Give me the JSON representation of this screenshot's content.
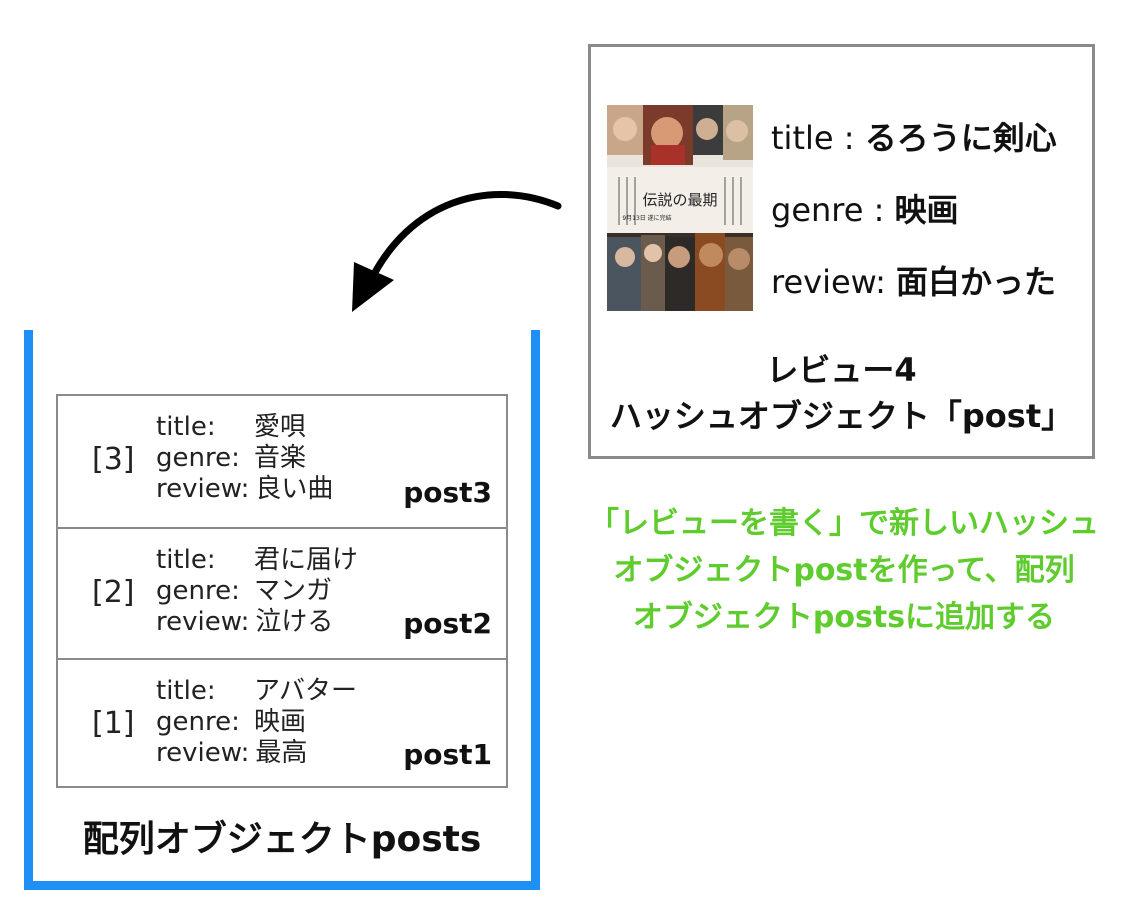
{
  "array": {
    "caption": "配列オブジェクトposts",
    "rows": [
      {
        "index": "[3]",
        "title_key": "title:",
        "title_value": "愛唄",
        "genre_key": "genre:",
        "genre_value": "音楽",
        "review_key": "review:",
        "review_value": "良い曲",
        "name": "post3"
      },
      {
        "index": "[2]",
        "title_key": "title:",
        "title_value": "君に届け",
        "genre_key": "genre:",
        "genre_value": "マンガ",
        "review_key": "review:",
        "review_value": "泣ける",
        "name": "post2"
      },
      {
        "index": "[1]",
        "title_key": "title:",
        "title_value": "アバター",
        "genre_key": "genre:",
        "genre_value": "映画",
        "review_key": "review:",
        "review_value": "最高",
        "name": "post1"
      }
    ]
  },
  "hash": {
    "title_key": "title : ",
    "title_value": "るろうに剣心",
    "genre_key": "genre : ",
    "genre_value": "映画",
    "review_key": "review: ",
    "review_value": "面白かった",
    "caption_line1": "レビュー4",
    "caption_line2": "ハッシュオブジェクト「post」",
    "poster": {
      "headline": "伝説の最期",
      "tagline": "9月13日 遂に完結"
    }
  },
  "note": {
    "line1": "「レビューを書く」で新しいハッシュ",
    "line2": "オブジェクトpostを作って、配列",
    "line3": "オブジェクトpostsに追加する"
  },
  "colors": {
    "array_border": "#1e90f5",
    "box_border": "#8a8a8a",
    "note_text": "#5fcc2e",
    "arrow": "#000000"
  }
}
